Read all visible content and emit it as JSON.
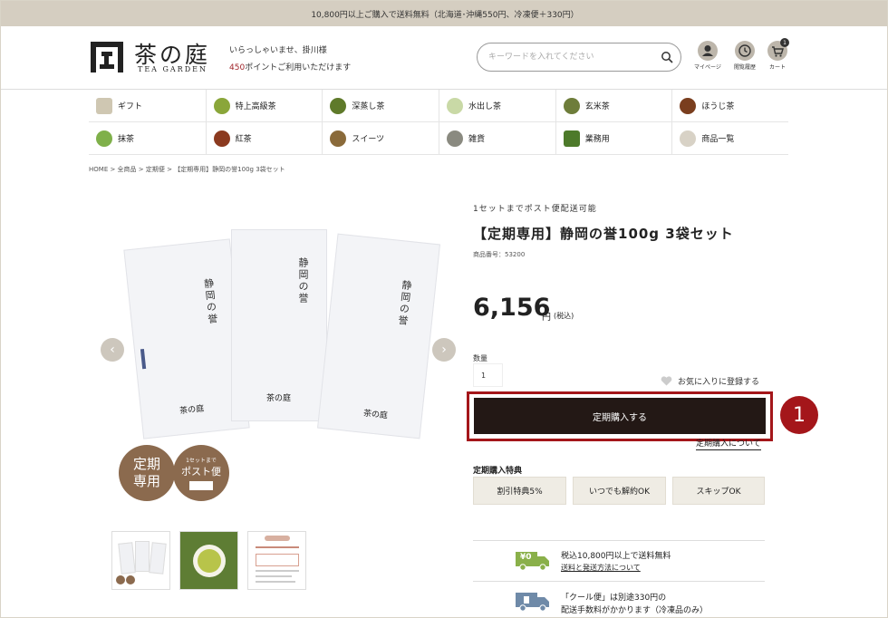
{
  "topbar": {
    "text": "10,800円以上ご購入で送料無料（北海道･沖縄550円、冷凍便＋330円）"
  },
  "header": {
    "logo_main": "茶の庭",
    "logo_sub": "TEA GARDEN",
    "welcome": "いらっしゃいませ、掛川様",
    "points_num": "450",
    "points_suffix": "ポイントご利用いただけます",
    "search_placeholder": "キーワードを入れてください",
    "icons": {
      "mypage": "マイページ",
      "history": "閲覧履歴",
      "cart": "カート",
      "cart_count": "1"
    }
  },
  "categories": {
    "row1": [
      {
        "label": "ギフト",
        "color": "#cfc7b2"
      },
      {
        "label": "特上高級茶",
        "color": "#8aa63a"
      },
      {
        "label": "深蒸し茶",
        "color": "#5f7a2a"
      },
      {
        "label": "水出し茶",
        "color": "#c9d9a6"
      },
      {
        "label": "玄米茶",
        "color": "#6e7d3a"
      },
      {
        "label": "ほうじ茶",
        "color": "#7a3e1e"
      }
    ],
    "row2": [
      {
        "label": "抹茶",
        "color": "#7fb04a"
      },
      {
        "label": "紅茶",
        "color": "#8b3a1f"
      },
      {
        "label": "スイーツ",
        "color": "#8a6a3a"
      },
      {
        "label": "雑貨",
        "color": "#8a8a80"
      },
      {
        "label": "業務用",
        "color": "#4d7a2a"
      },
      {
        "label": "商品一覧",
        "color": "#d8d2c6"
      }
    ]
  },
  "breadcrumb": "HOME > 全商品 > 定期便 > 【定期専用】静岡の誉100g 3袋セット",
  "gallery": {
    "bag_title": "静岡の誉",
    "bag_brand": "茶の庭",
    "badge1": [
      "定期",
      "専用"
    ],
    "badge2_small": "1セットまで",
    "badge2_big": "ポスト便"
  },
  "product": {
    "ship_note": "1セットまでポスト便配送可能",
    "title": "【定期専用】静岡の誉100g 3袋セット",
    "code": "商品番号：53200",
    "price": "6,156",
    "price_unit": "円",
    "price_tax": "(税込)",
    "qty_label": "数量",
    "qty_value": "1",
    "favorite": "お気に入りに登録する",
    "buy_button": "定期購入する",
    "marker": "1",
    "about_link": "定期購入について",
    "perks_title": "定期購入特典",
    "perks": [
      "割引特典5%",
      "いつでも解約OK",
      "スキップOK"
    ]
  },
  "shipping": [
    {
      "line1": "税込10,800円以上で送料無料",
      "line2": "送料と発送方法について",
      "icon": "free-shipping-truck-icon",
      "icon_label": "¥0",
      "color": "#8ab04a"
    },
    {
      "line1": "「クール便」は別途330円の",
      "line2": "配送手数料がかかります（冷凍品のみ）",
      "icon": "cool-truck-icon",
      "color": "#6f8aa8"
    }
  ]
}
